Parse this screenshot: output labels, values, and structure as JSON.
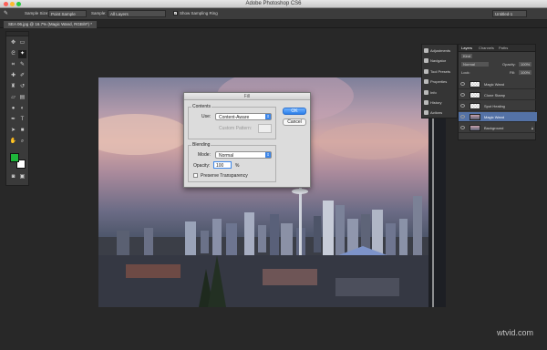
{
  "window": {
    "title": "Adobe Photoshop CS6"
  },
  "options_bar": {
    "sample_size_label": "Sample Size:",
    "sample_size_value": "Point Sample",
    "sample_label": "Sample:",
    "sample_value": "All Layers",
    "show_ring_label": "Show Sampling Ring",
    "workspace_value": "Untitled-1"
  },
  "document_tab": {
    "label": "SEA 06.jpg @ 16.7% (Magic Wand, RGB/8*) *"
  },
  "dialog": {
    "title": "Fill",
    "contents_label": "Contents",
    "use_label": "Use:",
    "use_value": "Content-Aware",
    "custom_pattern_label": "Custom Pattern:",
    "blending_label": "Blending",
    "mode_label": "Mode:",
    "mode_value": "Normal",
    "opacity_label": "Opacity:",
    "opacity_value": "100",
    "opacity_unit": "%",
    "preserve_label": "Preserve Transparency",
    "ok_label": "OK",
    "cancel_label": "Cancel"
  },
  "dock": {
    "items": [
      "Adjustments",
      "Navigator",
      "Tool Presets",
      "Properties",
      "Info",
      "History",
      "Actions"
    ]
  },
  "layers_panel": {
    "tabs": [
      "Layers",
      "Channels",
      "Paths"
    ],
    "kind_label": "Kind",
    "blend_mode": "Normal",
    "opacity_label": "Opacity:",
    "opacity_value": "100%",
    "lock_label": "Lock:",
    "fill_label": "Fill:",
    "fill_value": "100%",
    "layers": [
      {
        "name": "Magic Wand"
      },
      {
        "name": "Clone Stamp"
      },
      {
        "name": "Spot Healing"
      },
      {
        "name": "Magic Wand"
      },
      {
        "name": "Background"
      }
    ]
  },
  "watermark": {
    "text": "wtvid.com"
  },
  "colors": {
    "foreground": "#1eb53a",
    "background": "#ffffff",
    "accent": "#3d86e8"
  }
}
